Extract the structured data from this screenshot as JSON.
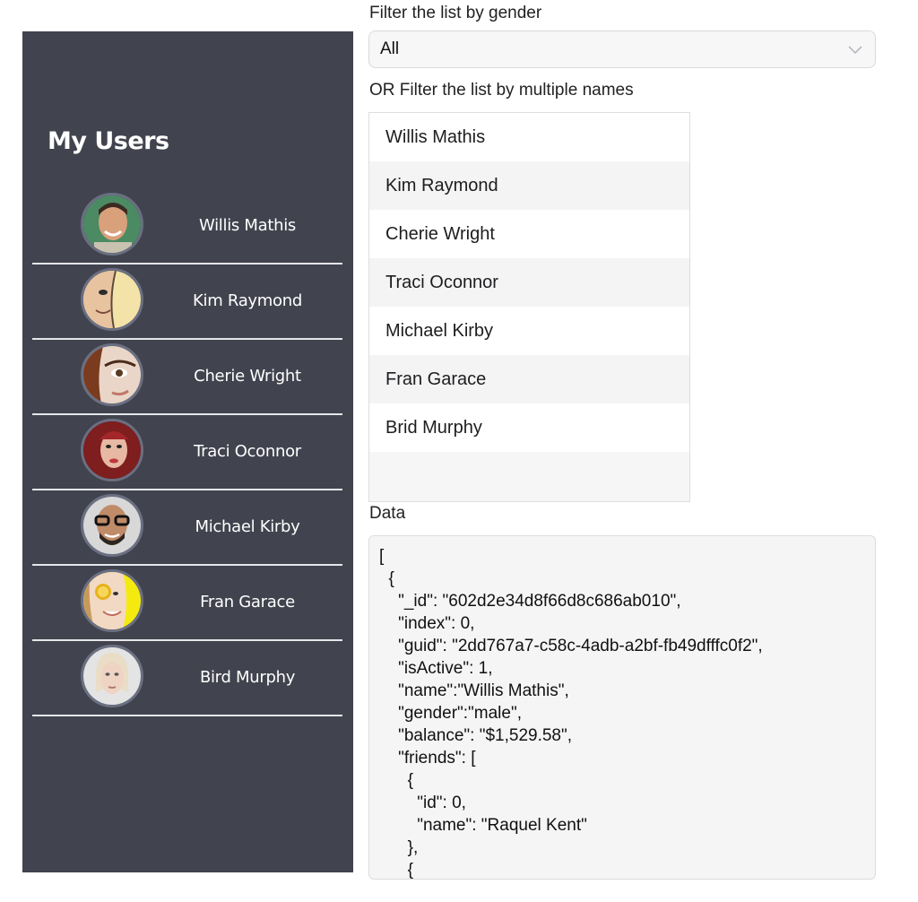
{
  "sidebar": {
    "title": "My Users",
    "users": [
      {
        "name": "Willis Mathis"
      },
      {
        "name": "Kim Raymond"
      },
      {
        "name": "Cherie Wright"
      },
      {
        "name": "Traci Oconnor"
      },
      {
        "name": "Michael Kirby"
      },
      {
        "name": "Fran Garace"
      },
      {
        "name": "Bird Murphy"
      }
    ]
  },
  "gender_filter": {
    "label": "Filter the list by gender",
    "selected": "All"
  },
  "names_filter": {
    "label": "OR Filter the list by multiple names",
    "options": [
      "Willis Mathis",
      "Kim Raymond",
      "Cherie Wright",
      "Traci Oconnor",
      "Michael Kirby",
      "Fran Garace",
      "Brid Murphy"
    ]
  },
  "data_panel": {
    "label": "Data",
    "json_text": "[\n  {\n    \"_id\": \"602d2e34d8f66d8c686ab010\",\n    \"index\": 0,\n    \"guid\": \"2dd767a7-c58c-4adb-a2bf-fb49dfffc0f2\",\n    \"isActive\": 1,\n    \"name\":\"Willis Mathis\",\n    \"gender\":\"male\",\n    \"balance\": \"$1,529.58\",\n    \"friends\": [\n      {\n        \"id\": 0,\n        \"name\": \"Raquel Kent\"\n      },\n      {"
  },
  "colors": {
    "sidebar_bg": "#41434e",
    "avatar_ring": "#6a6f82",
    "divider": "#e6e6ea"
  }
}
